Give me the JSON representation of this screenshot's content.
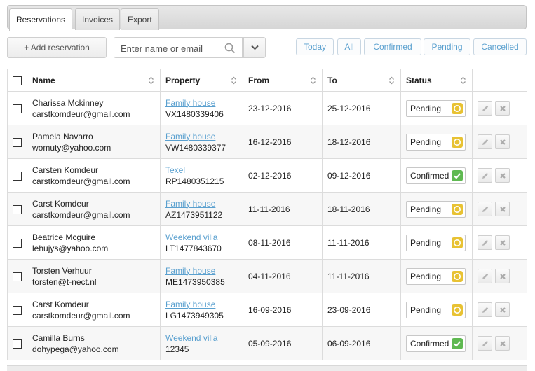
{
  "tabs": [
    {
      "label": "Reservations"
    },
    {
      "label": "Invoices"
    },
    {
      "label": "Export"
    }
  ],
  "toolbar": {
    "add_label": "+ Add reservation",
    "search_placeholder": "Enter name or email",
    "filters": [
      "Today",
      "All",
      "Confirmed",
      "Pending",
      "Cancelled"
    ]
  },
  "columns": [
    "Name",
    "Property",
    "From",
    "To",
    "Status"
  ],
  "rows": [
    {
      "name": "Charissa Mckinney",
      "email": "carstkomdeur@gmail.com",
      "property": "Family house",
      "code": "VX1480339406",
      "from": "23-12-2016",
      "to": "25-12-2016",
      "status": "Pending"
    },
    {
      "name": "Pamela Navarro",
      "email": "womuty@yahoo.com",
      "property": "Family house",
      "code": "VW1480339377",
      "from": "16-12-2016",
      "to": "18-12-2016",
      "status": "Pending"
    },
    {
      "name": "Carsten Komdeur",
      "email": "carstkomdeur@gmail.com",
      "property": "Texel",
      "code": "RP1480351215",
      "from": "02-12-2016",
      "to": "09-12-2016",
      "status": "Confirmed"
    },
    {
      "name": "Carst Komdeur",
      "email": "carstkomdeur@gmail.com",
      "property": "Family house",
      "code": "AZ1473951122",
      "from": "11-11-2016",
      "to": "18-11-2016",
      "status": "Pending"
    },
    {
      "name": "Beatrice Mcguire",
      "email": "lehujys@yahoo.com",
      "property": "Weekend villa",
      "code": "LT1477843670",
      "from": "08-11-2016",
      "to": "11-11-2016",
      "status": "Pending"
    },
    {
      "name": "Torsten Verhuur",
      "email": "torsten@t-nect.nl",
      "property": "Family house",
      "code": "ME1473950385",
      "from": "04-11-2016",
      "to": "11-11-2016",
      "status": "Pending"
    },
    {
      "name": "Carst Komdeur",
      "email": "carstkomdeur@gmail.com",
      "property": "Family house",
      "code": "LG1473949305",
      "from": "16-09-2016",
      "to": "23-09-2016",
      "status": "Pending"
    },
    {
      "name": "Camilla Burns",
      "email": "dohypega@yahoo.com",
      "property": "Weekend villa",
      "code": "12345",
      "from": "05-09-2016",
      "to": "06-09-2016",
      "status": "Confirmed"
    }
  ],
  "colors": {
    "link": "#5aa0cf",
    "pending": "#e8c233",
    "confirmed": "#5fb951"
  },
  "icons": {
    "search": "search-icon",
    "dropdown": "chevron-down-icon",
    "sort": "sort-icon",
    "edit": "pencil-icon",
    "delete": "close-icon",
    "pending": "clock-icon",
    "confirmed": "check-icon"
  }
}
